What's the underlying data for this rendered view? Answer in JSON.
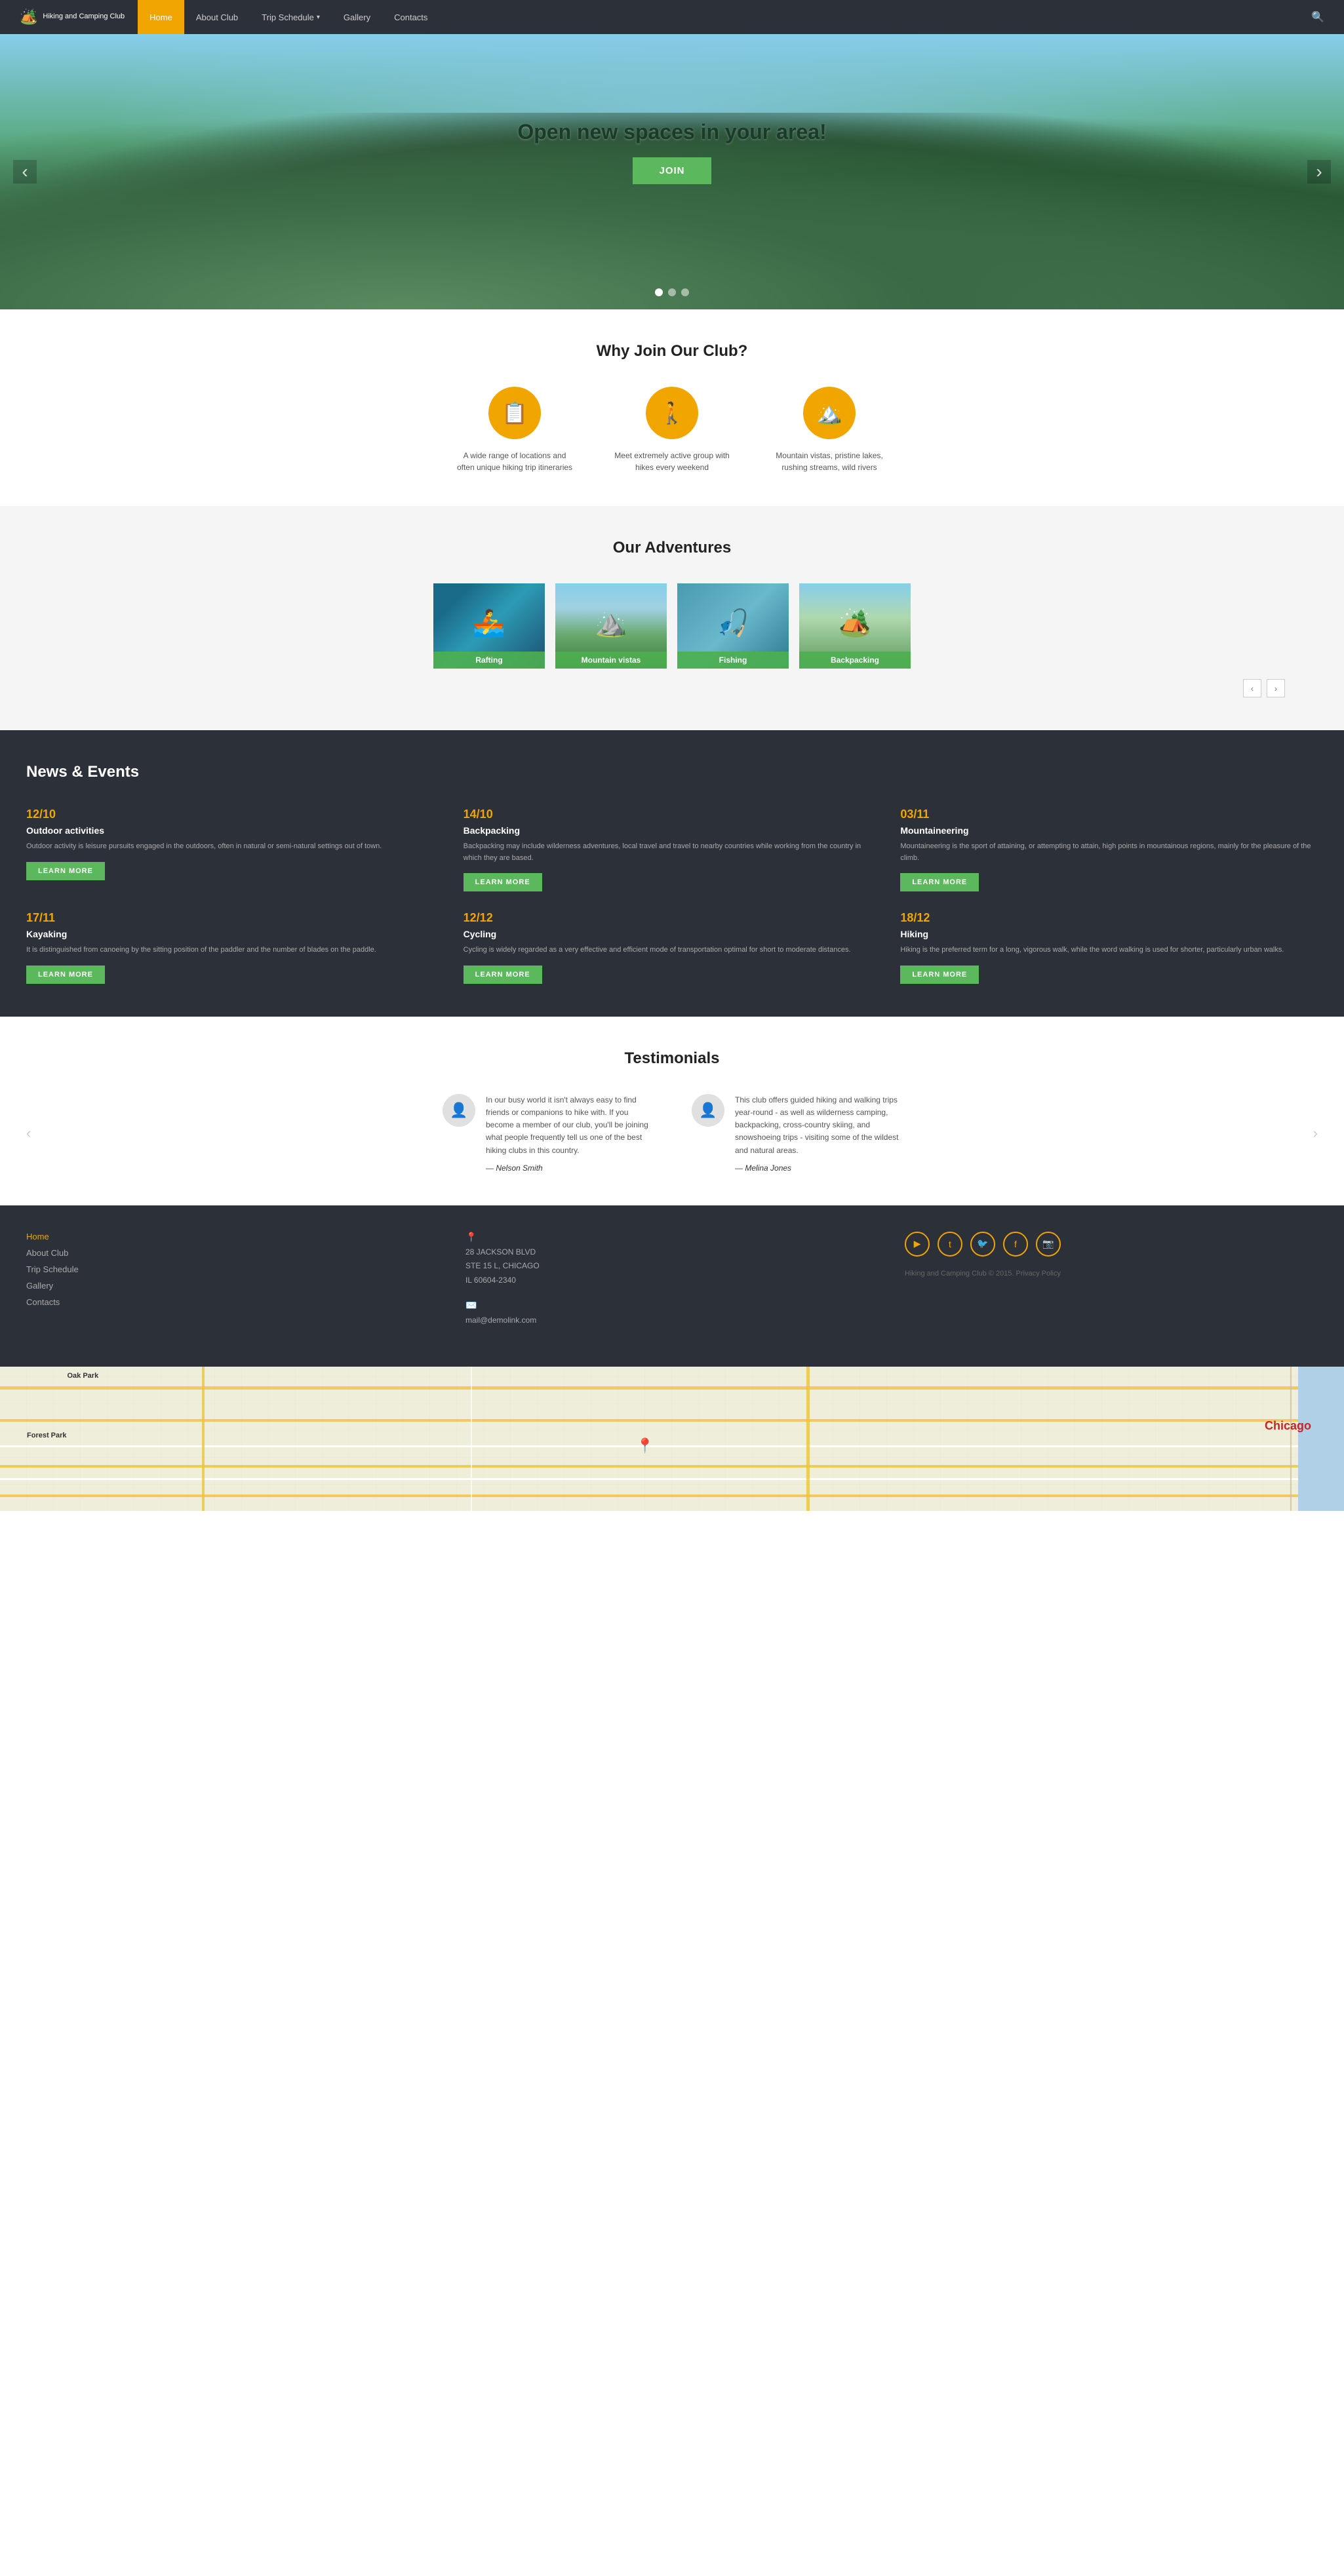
{
  "site": {
    "name": "Hiking and Camping Club",
    "logo_icon": "⛰️"
  },
  "nav": {
    "items": [
      {
        "label": "Home",
        "active": true
      },
      {
        "label": "About Club",
        "active": false
      },
      {
        "label": "Trip Schedule",
        "active": false,
        "dropdown": true
      },
      {
        "label": "Gallery",
        "active": false
      },
      {
        "label": "Contacts",
        "active": false
      }
    ]
  },
  "hero": {
    "title": "Open new spaces in your area!",
    "join_btn": "JOIN",
    "dots": [
      true,
      false,
      false
    ]
  },
  "why": {
    "title": "Why Join Our Club?",
    "features": [
      {
        "icon": "📋",
        "text": "A wide range of locations and often unique hiking trip itineraries"
      },
      {
        "icon": "🚶",
        "text": "Meet extremely active group with hikes every weekend"
      },
      {
        "icon": "🏔️",
        "text": "Mountain vistas, pristine lakes, rushing streams, wild rivers"
      }
    ]
  },
  "adventures": {
    "title": "Our Adventures",
    "items": [
      {
        "label": "Rafting",
        "class": "adv-rafting"
      },
      {
        "label": "Mountain vistas",
        "class": "adv-mountain"
      },
      {
        "label": "Fishing",
        "class": "adv-fishing"
      },
      {
        "label": "Backpacking",
        "class": "adv-backpacking"
      }
    ]
  },
  "news": {
    "title": "News & Events",
    "items": [
      {
        "date": "12/10",
        "title": "Outdoor activities",
        "desc": "Outdoor activity is leisure pursuits engaged in the outdoors, often in natural or semi-natural settings out of town.",
        "btn": "LEARN MORE"
      },
      {
        "date": "14/10",
        "title": "Backpacking",
        "desc": "Backpacking may include wilderness adventures, local travel and travel to nearby countries while working from the country in which they are based.",
        "btn": "LEARN MORE"
      },
      {
        "date": "03/11",
        "title": "Mountaineering",
        "desc": "Mountaineering is the sport of attaining, or attempting to attain, high points in mountainous regions, mainly for the pleasure of the climb.",
        "btn": "LEARN MORE"
      },
      {
        "date": "17/11",
        "title": "Kayaking",
        "desc": "It is distinguished from canoeing by the sitting position of the paddler and the number of blades on the paddle.",
        "btn": "LEARN MORE"
      },
      {
        "date": "12/12",
        "title": "Cycling",
        "desc": "Cycling is widely regarded as a very effective and efficient mode of transportation optimal for short to moderate distances.",
        "btn": "LEARN MORE"
      },
      {
        "date": "18/12",
        "title": "Hiking",
        "desc": "Hiking is the preferred term for a long, vigorous walk, while the word walking is used for shorter, particularly urban walks.",
        "btn": "LEARN MORE"
      }
    ]
  },
  "testimonials": {
    "title": "Testimonials",
    "items": [
      {
        "avatar": "👤",
        "text": "In our busy world it isn't always easy to find friends or companions to hike with. If you become a member of our club, you'll be joining what people frequently tell us one of the best hiking clubs in this country.",
        "author": "— Nelson Smith"
      },
      {
        "avatar": "👤",
        "text": "This club offers guided hiking and walking trips year-round - as well as wilderness camping, backpacking, cross-country skiing, and snowshoeing trips - visiting some of the wildest and natural areas.",
        "author": "— Melina Jones"
      }
    ]
  },
  "footer": {
    "links": [
      {
        "label": "Home",
        "active": true
      },
      {
        "label": "About Club",
        "active": false
      },
      {
        "label": "Trip Schedule",
        "active": false
      },
      {
        "label": "Gallery",
        "active": false
      },
      {
        "label": "Contacts",
        "active": false
      }
    ],
    "address": {
      "street": "28 JACKSON BLVD",
      "suite": "STE 15 L, CHICAGO",
      "zip": "IL 60604-2340"
    },
    "email": "mail@demolink.com",
    "social": [
      "▶",
      "t",
      "🐦",
      "f",
      "📷"
    ],
    "copyright": "Hiking and Camping Club © 2015. Privacy Policy"
  },
  "map": {
    "label_left": "Forest Park",
    "label_top": "Oak Park",
    "label_right": "Chicago"
  }
}
